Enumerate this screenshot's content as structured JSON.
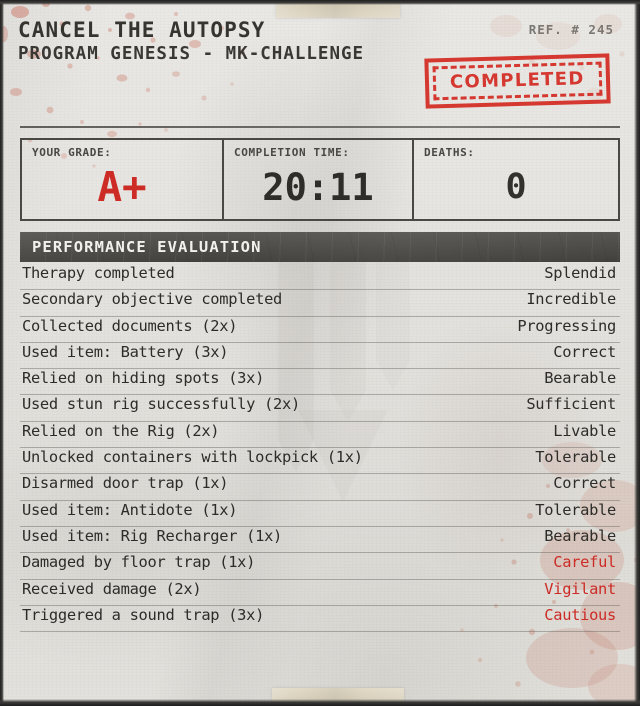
{
  "header": {
    "title": "CANCEL THE AUTOPSY",
    "subtitle": "PROGRAM GENESIS - MK-CHALLENGE",
    "reference": "REF. # 245",
    "stamp": "COMPLETED"
  },
  "stats": {
    "grade_label": "YOUR GRADE:",
    "grade_value": "A+",
    "time_label": "COMPLETION TIME:",
    "time_value": "20:11",
    "deaths_label": "DEATHS:",
    "deaths_value": "0"
  },
  "section": {
    "title": "PERFORMANCE EVALUATION"
  },
  "evaluation": {
    "rows": [
      {
        "label": "Therapy completed",
        "value": "Splendid",
        "negative": false
      },
      {
        "label": "Secondary objective completed",
        "value": "Incredible",
        "negative": false
      },
      {
        "label": "Collected documents (2x)",
        "value": "Progressing",
        "negative": false
      },
      {
        "label": "Used item: Battery (3x)",
        "value": "Correct",
        "negative": false
      },
      {
        "label": "Relied on hiding spots (3x)",
        "value": "Bearable",
        "negative": false
      },
      {
        "label": "Used stun rig successfully (2x)",
        "value": "Sufficient",
        "negative": false
      },
      {
        "label": "Relied on the Rig (2x)",
        "value": "Livable",
        "negative": false
      },
      {
        "label": "Unlocked containers with lockpick (1x)",
        "value": "Tolerable",
        "negative": false
      },
      {
        "label": "Disarmed door trap (1x)",
        "value": "Correct",
        "negative": false
      },
      {
        "label": "Used item: Antidote (1x)",
        "value": "Tolerable",
        "negative": false
      },
      {
        "label": "Used item: Rig Recharger (1x)",
        "value": "Bearable",
        "negative": false
      },
      {
        "label": "Damaged by floor trap (1x)",
        "value": "Careful",
        "negative": true
      },
      {
        "label": "Received damage (2x)",
        "value": "Vigilant",
        "negative": true
      },
      {
        "label": "Triggered a sound trap (3x)",
        "value": "Cautious",
        "negative": true
      }
    ]
  },
  "colors": {
    "accent_red": "#cc2b26",
    "stamp_red": "#cf2a22",
    "paper": "#e4e2de",
    "ink": "#2e2c29",
    "bar_dark": "#4b4945"
  }
}
